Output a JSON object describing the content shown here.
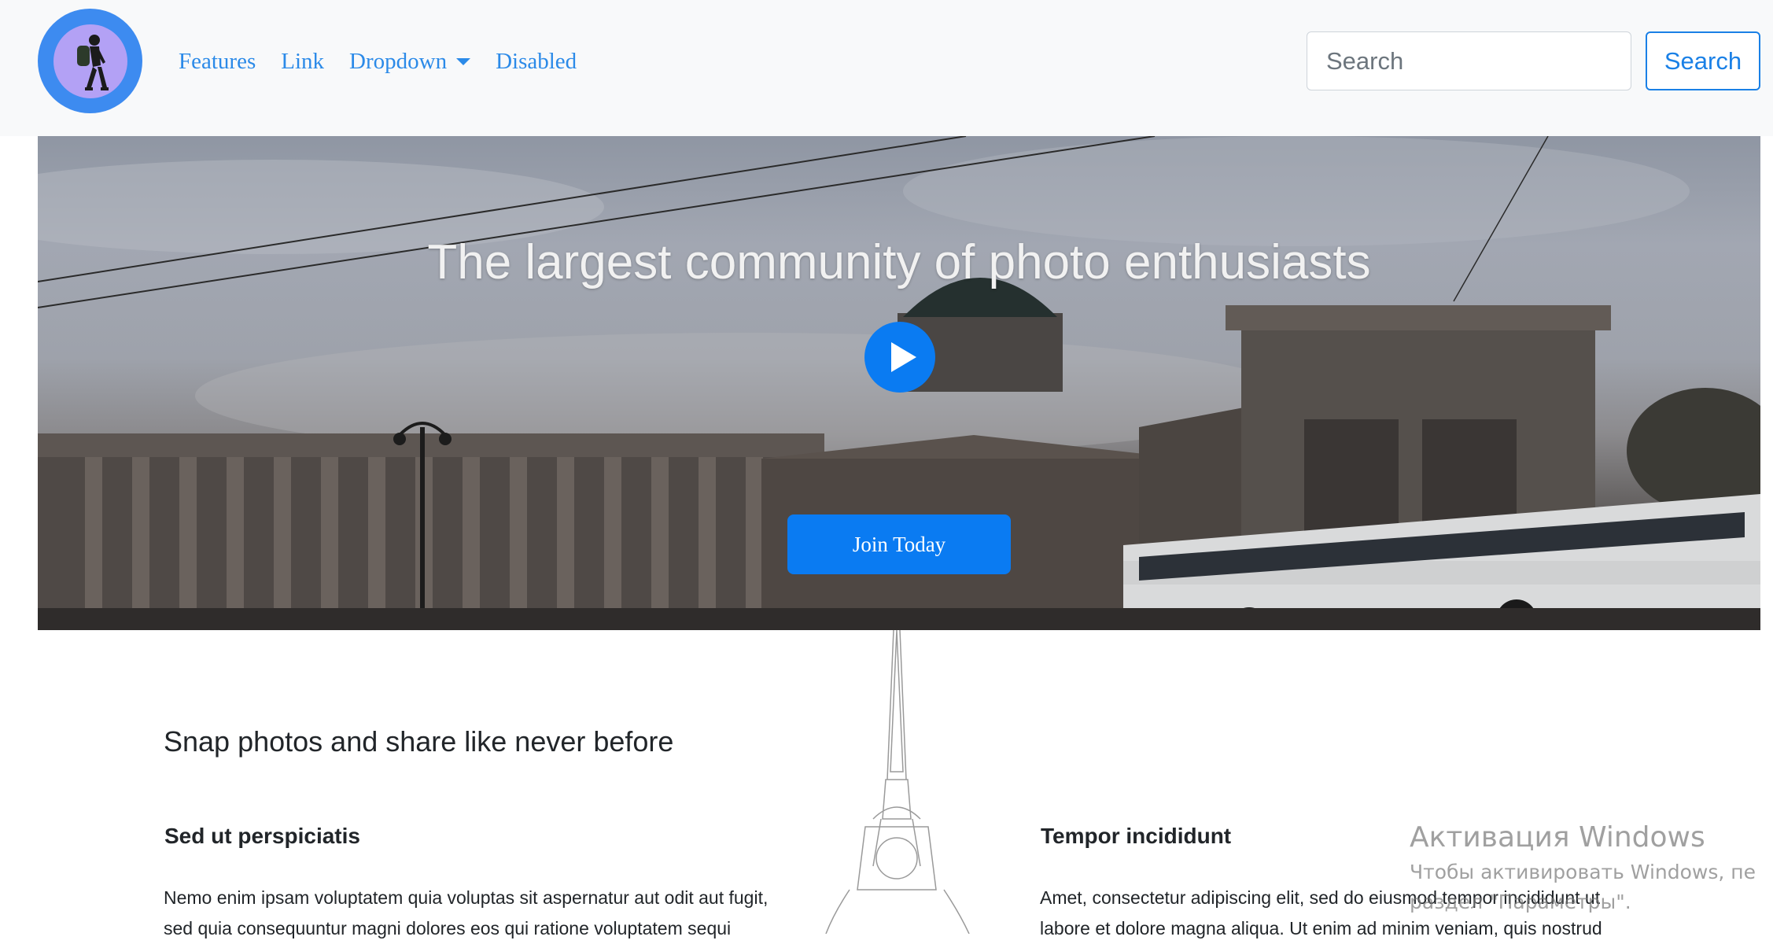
{
  "navbar": {
    "logo_alt": "hiker-logo",
    "links": [
      {
        "label": "Features"
      },
      {
        "label": "Link"
      },
      {
        "label": "Dropdown"
      },
      {
        "label": "Disabled"
      }
    ],
    "search": {
      "placeholder": "Search",
      "button_label": "Search"
    }
  },
  "hero": {
    "title": "The largest community of photo enthusiasts",
    "play_icon": "play-icon",
    "cta_label": "Join Today"
  },
  "content": {
    "heading": "Snap photos and share like never before",
    "columns": [
      {
        "title": "Sed ut perspiciatis",
        "text": "Nemo enim ipsam voluptatem quia voluptas sit aspernatur aut odit aut fugit, sed quia consequuntur magni dolores eos qui ratione voluptatem sequi"
      },
      {
        "title": "Tempor incididunt",
        "text": "Amet, consectetur adipiscing elit, sed do eiusmod tempor incididunt ut labore et dolore magna aliqua. Ut enim ad minim veniam, quis nostrud"
      }
    ]
  },
  "watermark": {
    "title": "Активация Windows",
    "line1": "Чтобы активировать Windows, пе",
    "line2": "раздел \"Параметры\"."
  },
  "colors": {
    "primary": "#0a7bf2",
    "link": "#2b8ae8",
    "navbar_bg": "#f8f9fa"
  }
}
